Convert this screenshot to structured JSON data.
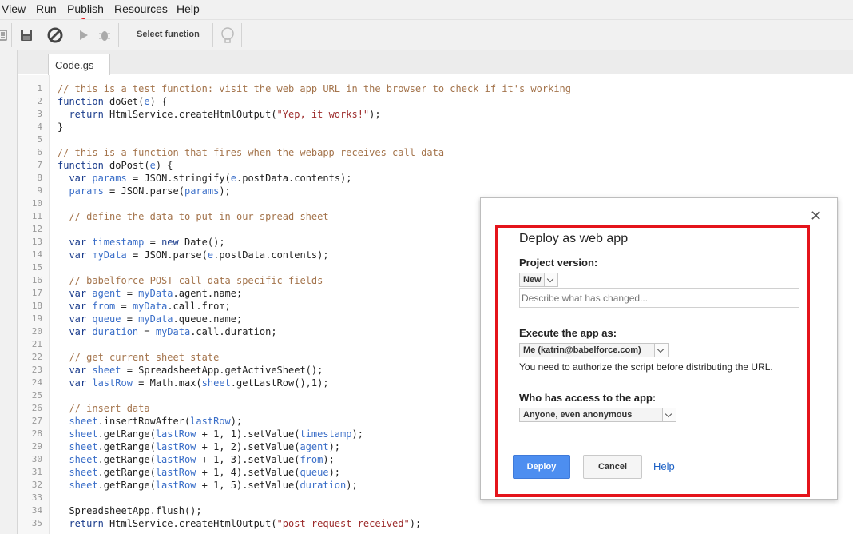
{
  "menu": [
    "View",
    "Run",
    "Publish",
    "Resources",
    "Help"
  ],
  "toolbar": {
    "select_function": "Select function"
  },
  "tab": {
    "name": "Code.gs"
  },
  "code": {
    "lines": [
      [
        [
          "c-com",
          "// this is a test function: visit the web app URL in the browser to check if it's working"
        ]
      ],
      [
        [
          "c-kw",
          "function "
        ],
        [
          "c-plain",
          "doGet("
        ],
        [
          "c-var",
          "e"
        ],
        [
          "c-plain",
          ") {"
        ]
      ],
      [
        [
          "c-plain",
          "  "
        ],
        [
          "c-kw",
          "return "
        ],
        [
          "c-plain",
          "HtmlService.createHtmlOutput("
        ],
        [
          "c-str",
          "\"Yep, it works!\""
        ],
        [
          "c-plain",
          ");"
        ]
      ],
      [
        [
          "c-plain",
          "}"
        ]
      ],
      [],
      [
        [
          "c-com",
          "// this is a function that fires when the webapp receives call data"
        ]
      ],
      [
        [
          "c-kw",
          "function "
        ],
        [
          "c-plain",
          "doPost("
        ],
        [
          "c-var",
          "e"
        ],
        [
          "c-plain",
          ") {"
        ]
      ],
      [
        [
          "c-plain",
          "  "
        ],
        [
          "c-kw",
          "var "
        ],
        [
          "c-var",
          "params"
        ],
        [
          "c-plain",
          " = JSON.stringify("
        ],
        [
          "c-var",
          "e"
        ],
        [
          "c-plain",
          ".postData.contents);"
        ]
      ],
      [
        [
          "c-plain",
          "  "
        ],
        [
          "c-var",
          "params"
        ],
        [
          "c-plain",
          " = JSON.parse("
        ],
        [
          "c-var",
          "params"
        ],
        [
          "c-plain",
          ");"
        ]
      ],
      [],
      [
        [
          "c-plain",
          "  "
        ],
        [
          "c-com",
          "// define the data to put in our spread sheet"
        ]
      ],
      [],
      [
        [
          "c-plain",
          "  "
        ],
        [
          "c-kw",
          "var "
        ],
        [
          "c-var",
          "timestamp"
        ],
        [
          "c-plain",
          " = "
        ],
        [
          "c-kw",
          "new "
        ],
        [
          "c-plain",
          "Date();"
        ]
      ],
      [
        [
          "c-plain",
          "  "
        ],
        [
          "c-kw",
          "var "
        ],
        [
          "c-var",
          "myData"
        ],
        [
          "c-plain",
          " = JSON.parse("
        ],
        [
          "c-var",
          "e"
        ],
        [
          "c-plain",
          ".postData.contents);"
        ]
      ],
      [],
      [
        [
          "c-plain",
          "  "
        ],
        [
          "c-com",
          "// babelforce POST call data specific fields"
        ]
      ],
      [
        [
          "c-plain",
          "  "
        ],
        [
          "c-kw",
          "var "
        ],
        [
          "c-var",
          "agent"
        ],
        [
          "c-plain",
          " = "
        ],
        [
          "c-var",
          "myData"
        ],
        [
          "c-plain",
          ".agent.name;"
        ]
      ],
      [
        [
          "c-plain",
          "  "
        ],
        [
          "c-kw",
          "var "
        ],
        [
          "c-var",
          "from"
        ],
        [
          "c-plain",
          " = "
        ],
        [
          "c-var",
          "myData"
        ],
        [
          "c-plain",
          ".call.from;"
        ]
      ],
      [
        [
          "c-plain",
          "  "
        ],
        [
          "c-kw",
          "var "
        ],
        [
          "c-var",
          "queue"
        ],
        [
          "c-plain",
          " = "
        ],
        [
          "c-var",
          "myData"
        ],
        [
          "c-plain",
          ".queue.name;"
        ]
      ],
      [
        [
          "c-plain",
          "  "
        ],
        [
          "c-kw",
          "var "
        ],
        [
          "c-var",
          "duration"
        ],
        [
          "c-plain",
          " = "
        ],
        [
          "c-var",
          "myData"
        ],
        [
          "c-plain",
          ".call.duration;"
        ]
      ],
      [],
      [
        [
          "c-plain",
          "  "
        ],
        [
          "c-com",
          "// get current sheet state"
        ]
      ],
      [
        [
          "c-plain",
          "  "
        ],
        [
          "c-kw",
          "var "
        ],
        [
          "c-var",
          "sheet"
        ],
        [
          "c-plain",
          " = SpreadsheetApp.getActiveSheet();"
        ]
      ],
      [
        [
          "c-plain",
          "  "
        ],
        [
          "c-kw",
          "var "
        ],
        [
          "c-var",
          "lastRow"
        ],
        [
          "c-plain",
          " = Math.max("
        ],
        [
          "c-var",
          "sheet"
        ],
        [
          "c-plain",
          ".getLastRow(),1);"
        ]
      ],
      [],
      [
        [
          "c-plain",
          "  "
        ],
        [
          "c-com",
          "// insert data"
        ]
      ],
      [
        [
          "c-plain",
          "  "
        ],
        [
          "c-var",
          "sheet"
        ],
        [
          "c-plain",
          ".insertRowAfter("
        ],
        [
          "c-var",
          "lastRow"
        ],
        [
          "c-plain",
          ");"
        ]
      ],
      [
        [
          "c-plain",
          "  "
        ],
        [
          "c-var",
          "sheet"
        ],
        [
          "c-plain",
          ".getRange("
        ],
        [
          "c-var",
          "lastRow"
        ],
        [
          "c-plain",
          " + 1, 1).setValue("
        ],
        [
          "c-var",
          "timestamp"
        ],
        [
          "c-plain",
          ");"
        ]
      ],
      [
        [
          "c-plain",
          "  "
        ],
        [
          "c-var",
          "sheet"
        ],
        [
          "c-plain",
          ".getRange("
        ],
        [
          "c-var",
          "lastRow"
        ],
        [
          "c-plain",
          " + 1, 2).setValue("
        ],
        [
          "c-var",
          "agent"
        ],
        [
          "c-plain",
          ");"
        ]
      ],
      [
        [
          "c-plain",
          "  "
        ],
        [
          "c-var",
          "sheet"
        ],
        [
          "c-plain",
          ".getRange("
        ],
        [
          "c-var",
          "lastRow"
        ],
        [
          "c-plain",
          " + 1, 3).setValue("
        ],
        [
          "c-var",
          "from"
        ],
        [
          "c-plain",
          ");"
        ]
      ],
      [
        [
          "c-plain",
          "  "
        ],
        [
          "c-var",
          "sheet"
        ],
        [
          "c-plain",
          ".getRange("
        ],
        [
          "c-var",
          "lastRow"
        ],
        [
          "c-plain",
          " + 1, 4).setValue("
        ],
        [
          "c-var",
          "queue"
        ],
        [
          "c-plain",
          ");"
        ]
      ],
      [
        [
          "c-plain",
          "  "
        ],
        [
          "c-var",
          "sheet"
        ],
        [
          "c-plain",
          ".getRange("
        ],
        [
          "c-var",
          "lastRow"
        ],
        [
          "c-plain",
          " + 1, 5).setValue("
        ],
        [
          "c-var",
          "duration"
        ],
        [
          "c-plain",
          ");"
        ]
      ],
      [],
      [
        [
          "c-plain",
          "  SpreadsheetApp.flush();"
        ]
      ],
      [
        [
          "c-plain",
          "  "
        ],
        [
          "c-kw",
          "return "
        ],
        [
          "c-plain",
          "HtmlService.createHtmlOutput("
        ],
        [
          "c-str",
          "\"post request received\""
        ],
        [
          "c-plain",
          ");"
        ]
      ]
    ]
  },
  "dialog": {
    "title": "Deploy as web app",
    "project_version_label": "Project version:",
    "project_version_value": "New",
    "describe_placeholder": "Describe what has changed...",
    "execute_as_label": "Execute the app as:",
    "execute_as_value": "Me (katrin@babelforce.com)",
    "authorize_note": "You need to authorize the script before distributing the URL.",
    "access_label": "Who has access to the app:",
    "access_value": "Anyone, even anonymous",
    "deploy_label": "Deploy",
    "cancel_label": "Cancel",
    "help_label": "Help"
  },
  "colors": {
    "highlight_box": "#e4141b",
    "deploy_button": "#4d8ef0",
    "arrow": "#e4141b"
  }
}
